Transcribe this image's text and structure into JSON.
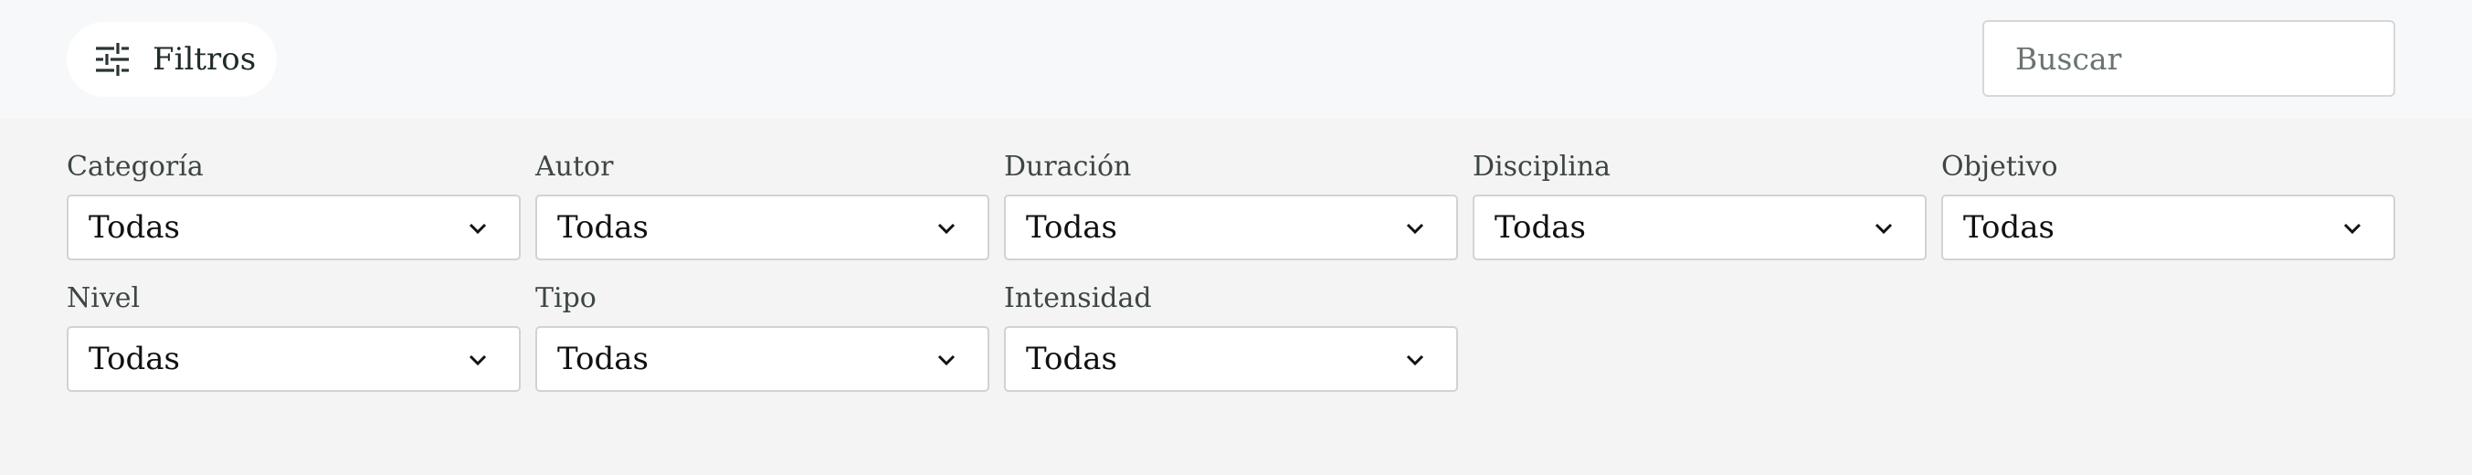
{
  "toolbar": {
    "filters_label": "Filtros",
    "filters_icon": "sliders-icon",
    "search_placeholder": "Buscar",
    "search_value": ""
  },
  "filters": [
    {
      "label": "Categoría",
      "value": "Todas"
    },
    {
      "label": "Autor",
      "value": "Todas"
    },
    {
      "label": "Duración",
      "value": "Todas"
    },
    {
      "label": "Disciplina",
      "value": "Todas"
    },
    {
      "label": "Objetivo",
      "value": "Todas"
    },
    {
      "label": "Nivel",
      "value": "Todas"
    },
    {
      "label": "Tipo",
      "value": "Todas"
    },
    {
      "label": "Intensidad",
      "value": "Todas"
    }
  ],
  "colors": {
    "topbar_bg": "#f7f8f9",
    "panel_bg": "#f4f4f4",
    "text": "#1f2a2a",
    "border": "#cfd3d6"
  }
}
